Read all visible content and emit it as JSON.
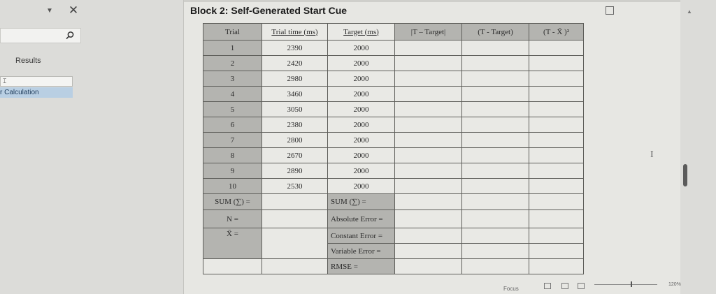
{
  "nav": {
    "results_label": "Results",
    "nav_item_1": "⌶",
    "nav_item_2": "r Calculation"
  },
  "document": {
    "heading": "Block 2: Self-Generated Start Cue",
    "table": {
      "headers": [
        "Trial",
        "Trial time (ms)",
        "Target (ms)",
        "|T – Target|",
        "(T - Target)",
        "(T - X̄ )²"
      ],
      "rows": [
        {
          "trial": "1",
          "time": "2390",
          "target": "2000"
        },
        {
          "trial": "2",
          "time": "2420",
          "target": "2000"
        },
        {
          "trial": "3",
          "time": "2980",
          "target": "2000"
        },
        {
          "trial": "4",
          "time": "3460",
          "target": "2000"
        },
        {
          "trial": "5",
          "time": "3050",
          "target": "2000"
        },
        {
          "trial": "6",
          "time": "2380",
          "target": "2000"
        },
        {
          "trial": "7",
          "time": "2800",
          "target": "2000"
        },
        {
          "trial": "8",
          "time": "2670",
          "target": "2000"
        },
        {
          "trial": "9",
          "time": "2890",
          "target": "2000"
        },
        {
          "trial": "10",
          "time": "2530",
          "target": "2000"
        }
      ],
      "summary": {
        "sum_left": "SUM (∑) =",
        "n_label": "N =",
        "mean_label": "X̄ =",
        "sum_right": "SUM (∑) =",
        "absolute_error": "Absolute Error =",
        "constant_error": "Constant Error =",
        "variable_error": "Variable Error =",
        "rmse": "RMSE ="
      }
    }
  },
  "status": {
    "focus": "Focus",
    "zoom": "120%"
  },
  "colors": {
    "header_gray": "#b4b4b0",
    "cell_light": "#e9e9e5",
    "nav_selected": "#b9cfe3"
  }
}
